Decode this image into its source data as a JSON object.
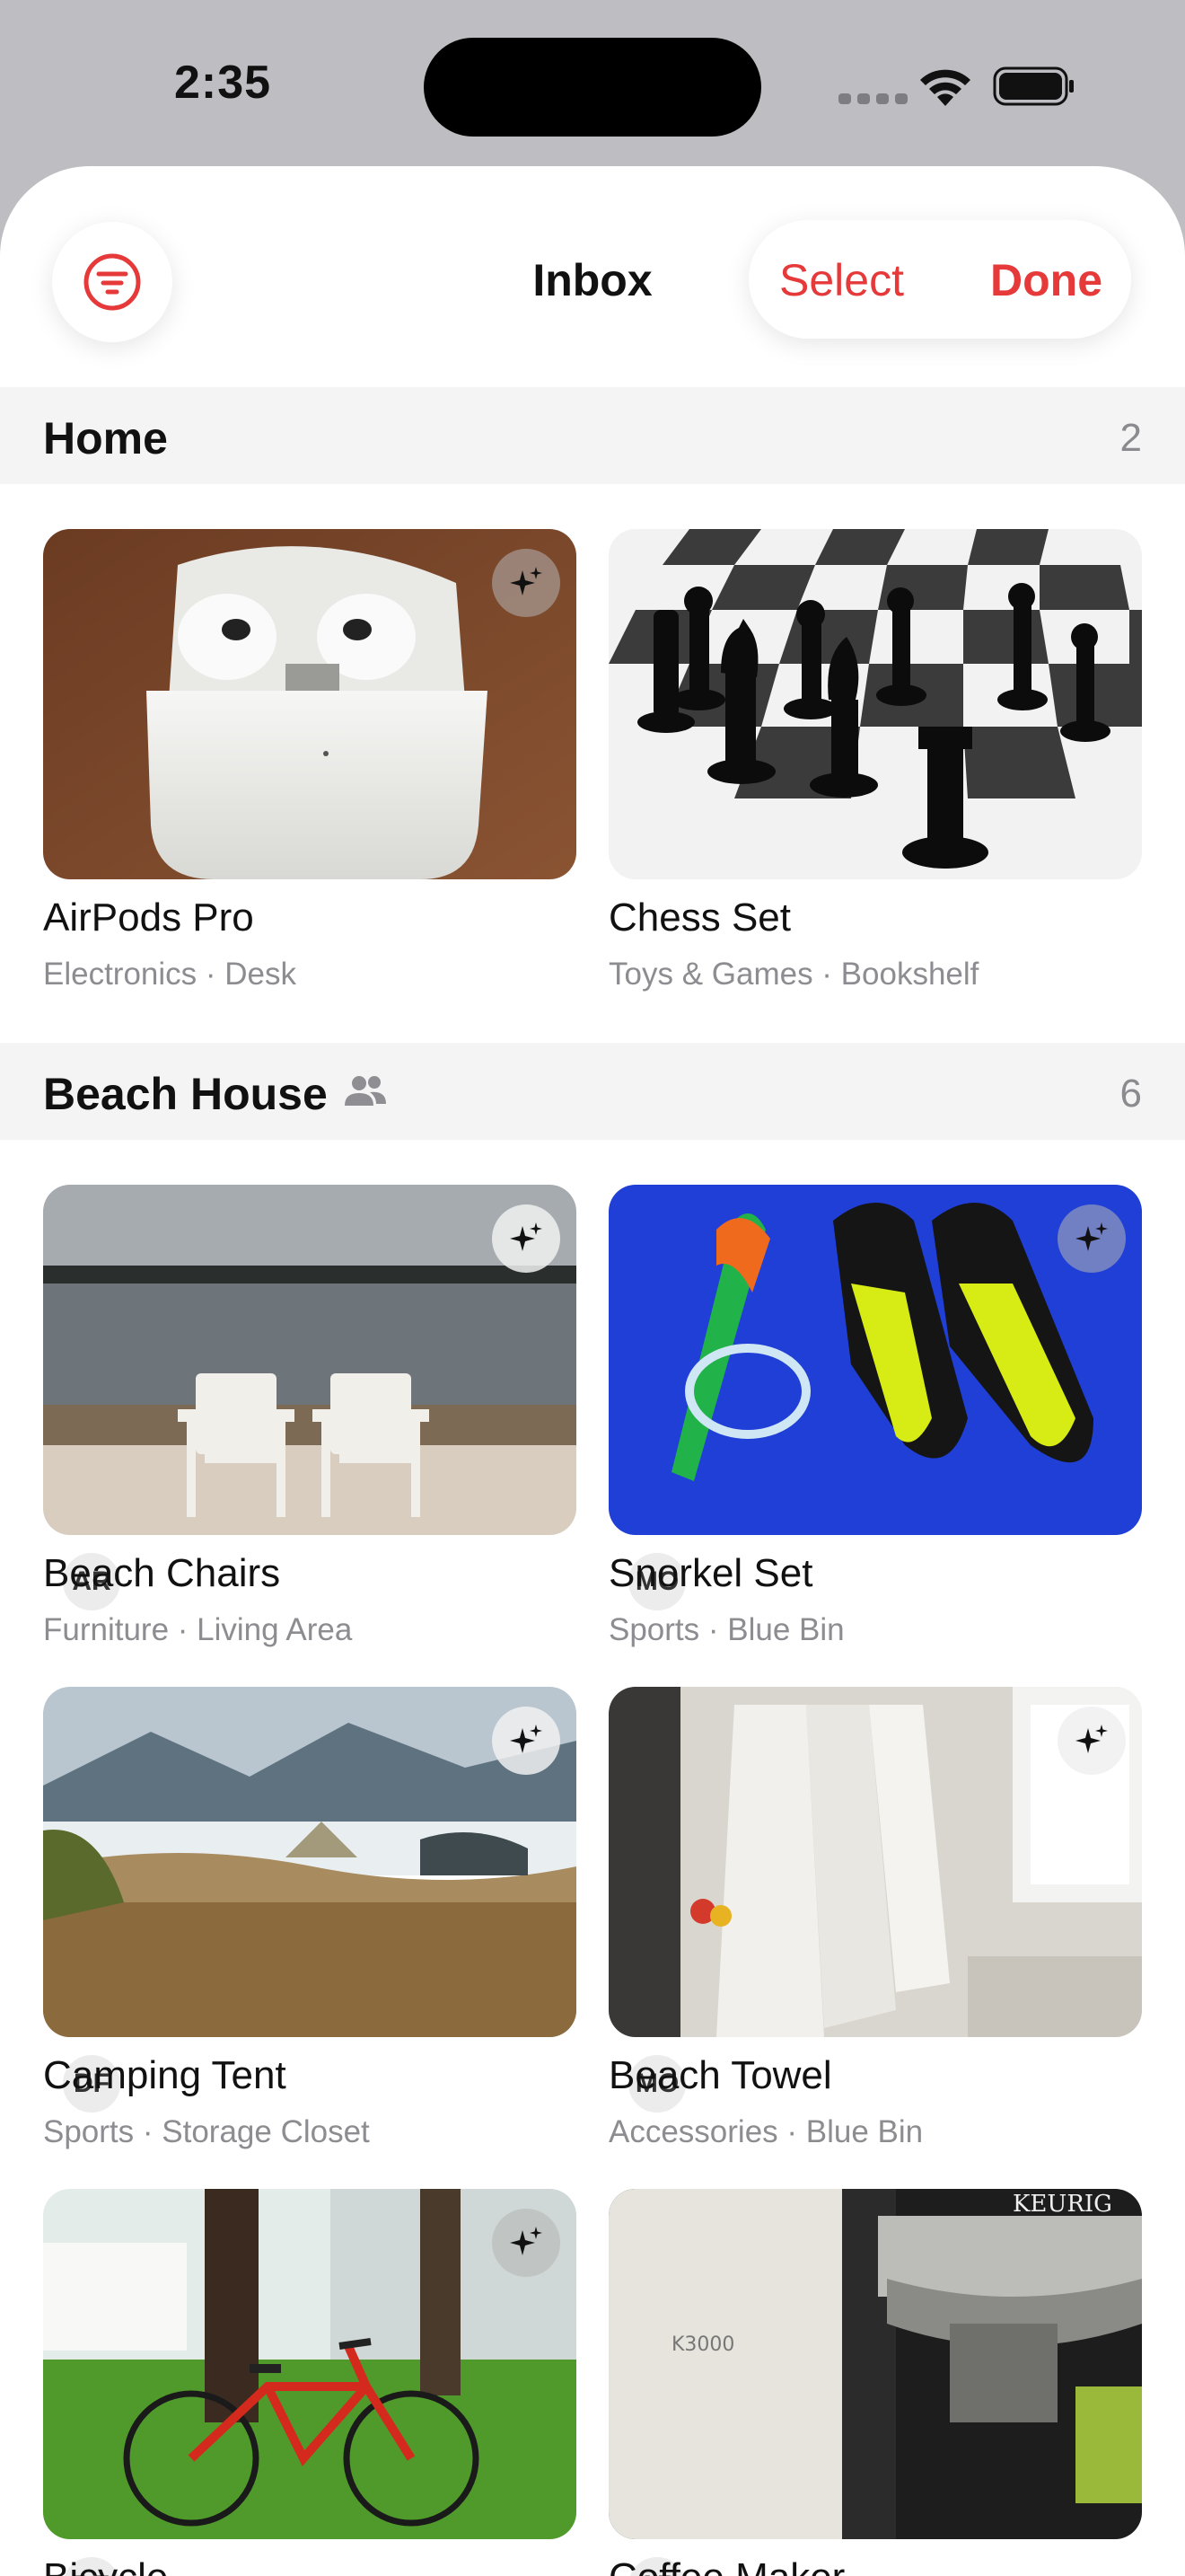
{
  "status_bar": {
    "time": "2:35"
  },
  "header": {
    "title": "Inbox",
    "select_label": "Select",
    "done_label": "Done",
    "accent_color": "#e5393a"
  },
  "sections": [
    {
      "title": "Home",
      "count": "2",
      "shared": false,
      "items": [
        {
          "title": "AirPods Pro",
          "subtitle": "Electronics · Desk",
          "owner": ""
        },
        {
          "title": "Chess Set",
          "subtitle": "Toys & Games · Bookshelf",
          "owner": ""
        }
      ]
    },
    {
      "title": "Beach House",
      "count": "6",
      "shared": true,
      "items": [
        {
          "title": "Beach Chairs",
          "subtitle": "Furniture · Living Area",
          "owner": "AR"
        },
        {
          "title": "Snorkel Set",
          "subtitle": "Sports · Blue Bin",
          "owner": "MO"
        },
        {
          "title": "Camping Tent",
          "subtitle": "Sports · Storage Closet",
          "owner": "DF"
        },
        {
          "title": "Beach Towel",
          "subtitle": "Accessories · Blue Bin",
          "owner": "MO"
        },
        {
          "title": "Bicycle",
          "subtitle": "",
          "owner": "DF"
        },
        {
          "title": "Coffee Maker",
          "subtitle": "",
          "owner": "AR"
        }
      ]
    }
  ],
  "photo_text": {
    "keurig_brand": "KEURIG",
    "keurig_model": "K3000"
  }
}
